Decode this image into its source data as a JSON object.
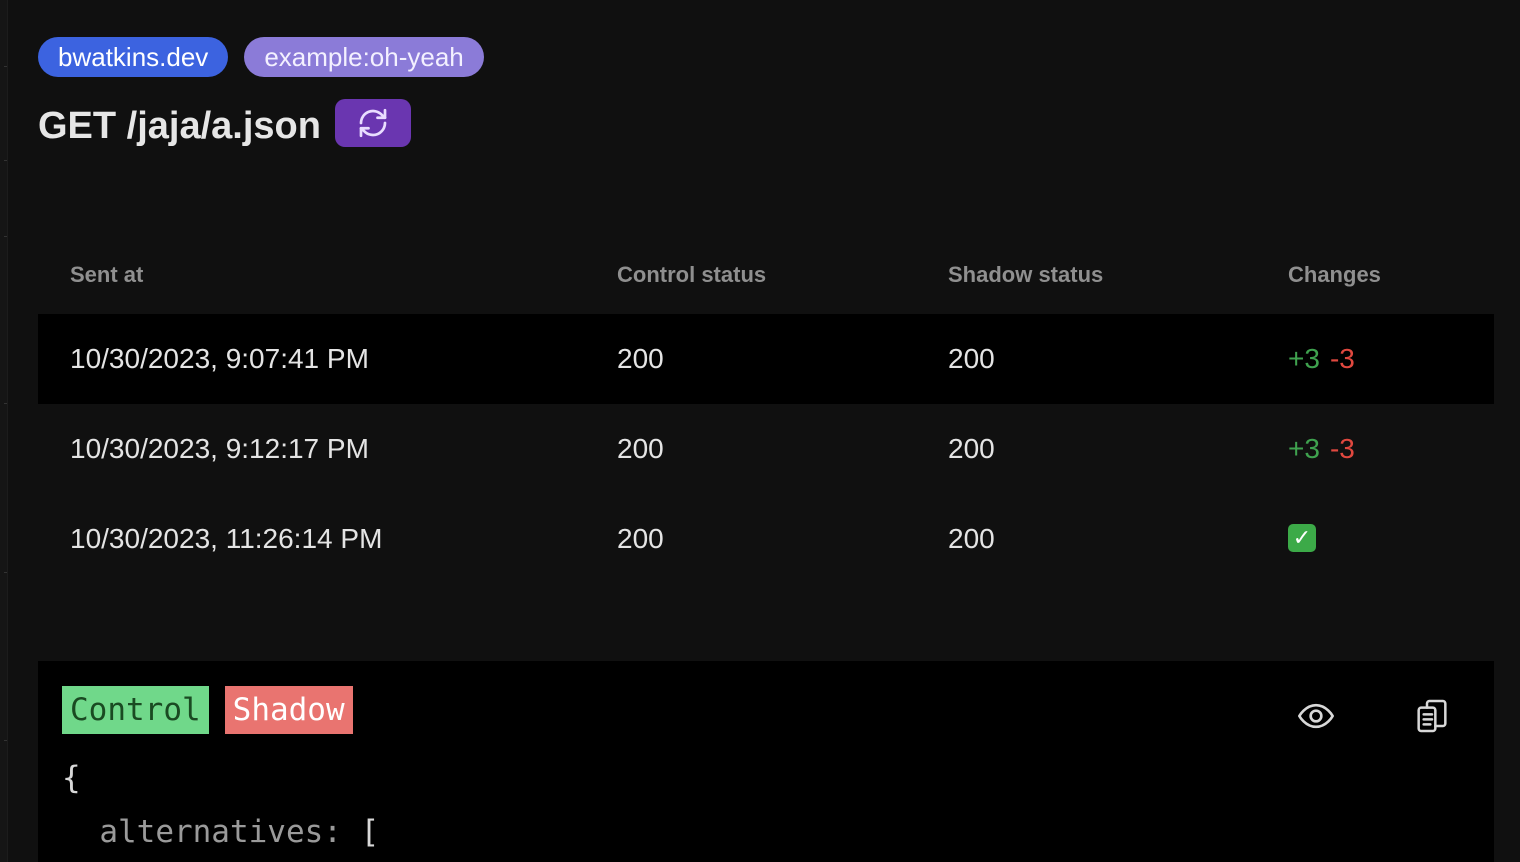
{
  "tags": {
    "host": "bwatkins.dev",
    "name": "example:oh-yeah"
  },
  "request": {
    "title": "GET /jaja/a.json",
    "refresh_icon": "refresh-icon"
  },
  "table": {
    "headers": {
      "sent_at": "Sent at",
      "control_status": "Control status",
      "shadow_status": "Shadow status",
      "changes": "Changes"
    },
    "rows": [
      {
        "sent_at": "10/30/2023, 9:07:41 PM",
        "control": "200",
        "shadow": "200",
        "added": "+3",
        "removed": "-3",
        "selected": true
      },
      {
        "sent_at": "10/30/2023, 9:12:17 PM",
        "control": "200",
        "shadow": "200",
        "added": "+3",
        "removed": "-3",
        "selected": false
      },
      {
        "sent_at": "10/30/2023, 11:26:14 PM",
        "control": "200",
        "shadow": "200",
        "match_icon": "check-mark-icon",
        "selected": false
      }
    ]
  },
  "diff": {
    "legend_control": "Control",
    "legend_shadow": "Shadow",
    "eye_icon": "eye-icon",
    "copy_icon": "copy-icon",
    "line1": "{",
    "line2_key": "alternatives:",
    "line2_bracket": " ["
  },
  "colors": {
    "host_tag": "#3c63e0",
    "name_tag": "#8b7bd8",
    "refresh_button": "#6a36b0",
    "added": "#3fa24f",
    "removed": "#e0483f",
    "legend_control": "#70d88a",
    "legend_shadow": "#e97470"
  }
}
